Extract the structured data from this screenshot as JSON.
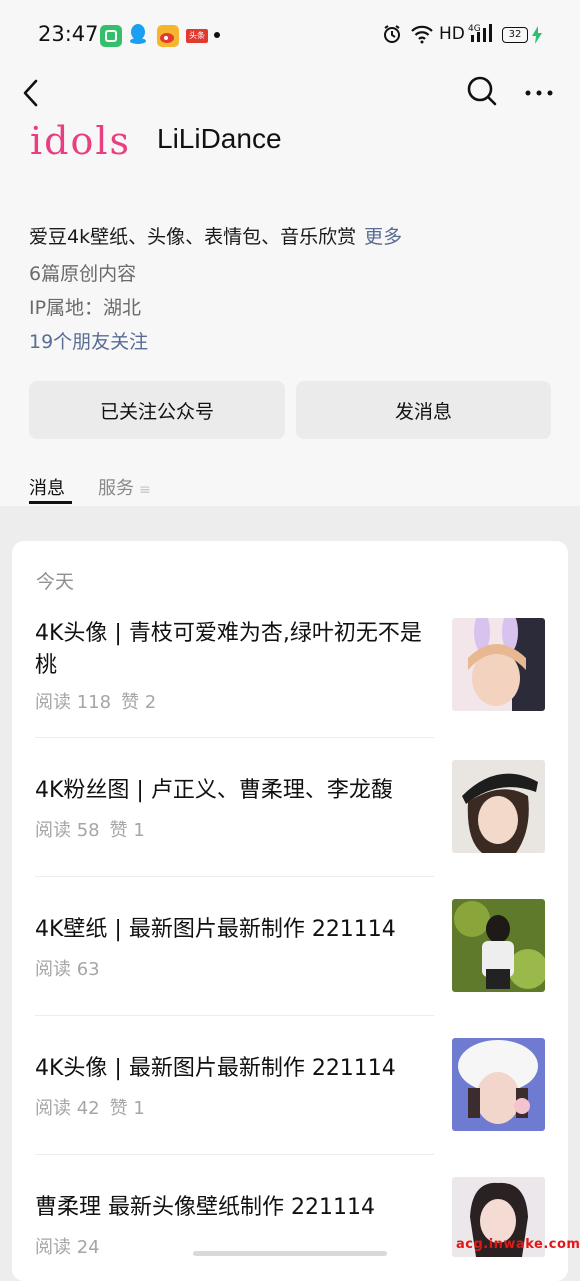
{
  "status_bar": {
    "time": "23:47",
    "network_label": "HD",
    "signal_label": "4G",
    "battery": "32",
    "notification_icons": [
      "green-app-icon",
      "qq-icon",
      "weibo-icon",
      "toutiao-icon"
    ],
    "toutiao_text": "头条"
  },
  "nav": {
    "back_icon": "back-icon",
    "search_icon": "search-icon",
    "more_icon": "more-icon"
  },
  "account": {
    "logo_text": "idols",
    "name": "LiLiDance",
    "description": "爱豆4k壁纸、头像、表情包、音乐欣赏",
    "description_more": "更多",
    "articles_count": "6篇原创内容",
    "ip_location": "IP属地：湖北",
    "friends_following": "19个朋友关注"
  },
  "actions": {
    "follow_label": "已关注公众号",
    "message_label": "发消息"
  },
  "tabs": {
    "messages": "消息",
    "services": "服务",
    "services_icon": "≡"
  },
  "feed": {
    "section_title": "今天",
    "items": [
      {
        "title": "4K头像 | 青枝可爱难为杏,绿叶初无不是桃",
        "reads": "阅读 118",
        "likes": "赞 2"
      },
      {
        "title": "4K粉丝图 | 卢正义、曹柔理、李龙馥",
        "reads": "阅读 58",
        "likes": "赞 1"
      },
      {
        "title": "4K壁纸 | 最新图片最新制作 221114",
        "reads": "阅读 63",
        "likes": ""
      },
      {
        "title": "4K头像 | 最新图片最新制作 221114",
        "reads": "阅读 42",
        "likes": "赞 1"
      },
      {
        "title": "曹柔理 最新头像壁纸制作 221114",
        "reads": "阅读 24",
        "likes": ""
      }
    ]
  },
  "watermark": "acg.inwake.com",
  "colors": {
    "link_blue": "#586c94",
    "header_bg": "#f7f7f7",
    "page_bg": "#ededed",
    "button_bg": "#ebebeb",
    "watermark_red": "#e01818"
  }
}
